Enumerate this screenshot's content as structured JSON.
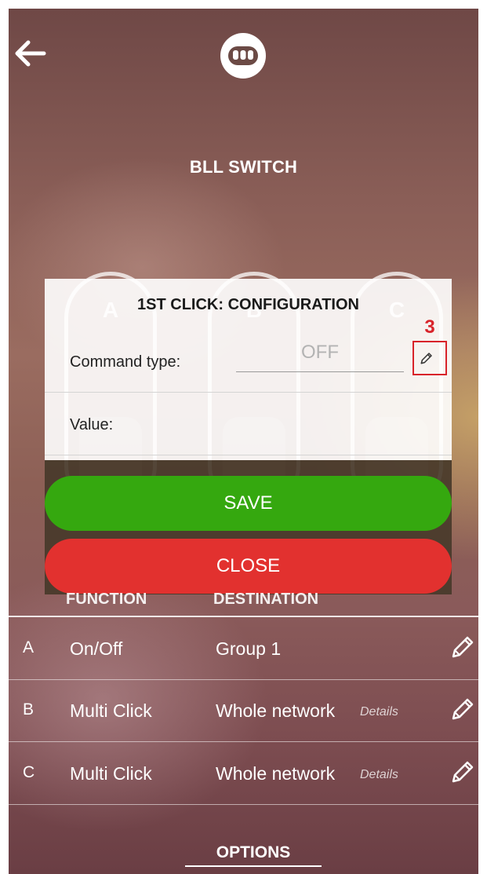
{
  "header": {
    "title": "BLL SWITCH"
  },
  "switches": [
    "A",
    "B",
    "C"
  ],
  "dialog": {
    "title": "1ST CLICK: CONFIGURATION",
    "command_type_label": "Command type:",
    "command_type_value": "OFF",
    "value_label": "Value:",
    "save_label": "SAVE",
    "close_label": "CLOSE"
  },
  "annotation": {
    "number": "3",
    "color": "#d8232a"
  },
  "table": {
    "headers": {
      "function": "FUNCTION",
      "destination": "DESTINATION"
    },
    "rows": [
      {
        "letter": "A",
        "function": "On/Off",
        "destination": "Group 1",
        "details": ""
      },
      {
        "letter": "B",
        "function": "Multi Click",
        "destination": "Whole network",
        "details": "Details"
      },
      {
        "letter": "C",
        "function": "Multi Click",
        "destination": "Whole network",
        "details": "Details"
      }
    ]
  },
  "footer": {
    "options_label": "OPTIONS"
  },
  "colors": {
    "save": "#35a80f",
    "close": "#e2312f"
  },
  "icons": [
    "back-arrow-icon",
    "device-switch-icon",
    "pencil-icon"
  ]
}
